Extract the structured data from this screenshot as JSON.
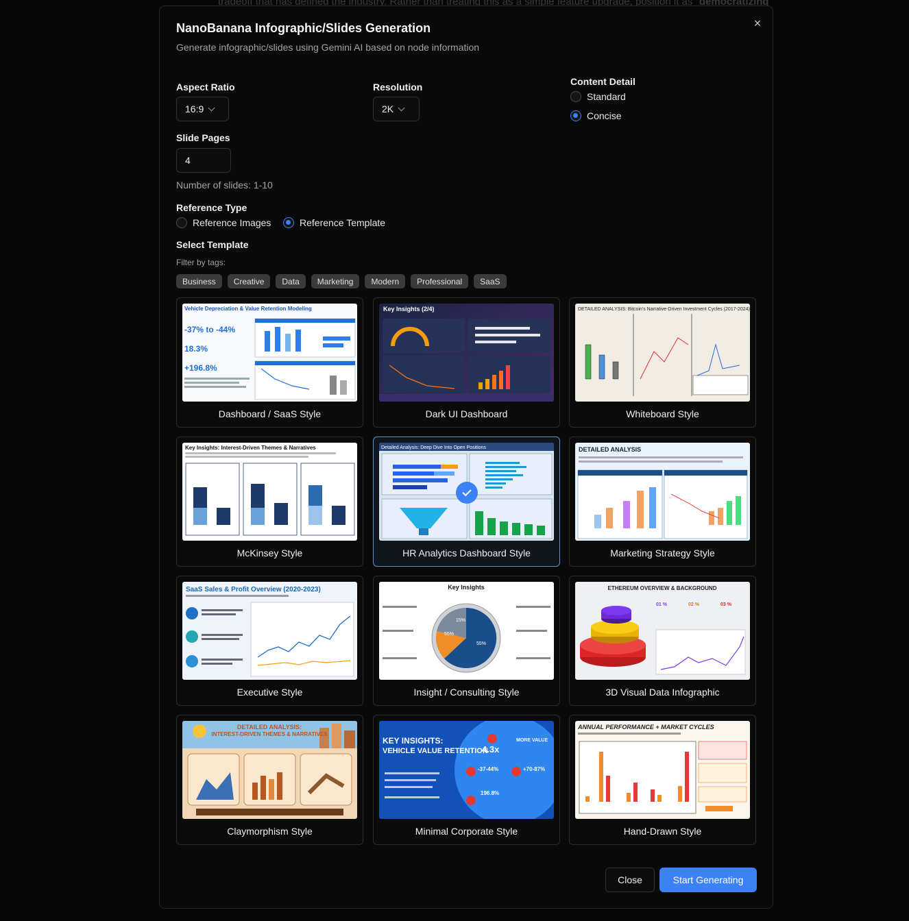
{
  "background": {
    "text": "tradeoff that has defined the industry. Rather than treating this as a simple feature upgrade, position it as",
    "bold": "democratizing"
  },
  "dialog": {
    "title": "NanoBanana Infographic/Slides Generation",
    "subtitle": "Generate infographic/slides using Gemini AI based on node information",
    "close_icon": "×"
  },
  "aspect_ratio": {
    "label": "Aspect Ratio",
    "value": "16:9"
  },
  "resolution": {
    "label": "Resolution",
    "value": "2K"
  },
  "content_detail": {
    "label": "Content Detail",
    "options": [
      "Standard",
      "Concise"
    ],
    "selected": "Concise"
  },
  "slide_pages": {
    "label": "Slide Pages",
    "value": "4",
    "hint": "Number of slides: 1-10"
  },
  "reference_type": {
    "label": "Reference Type",
    "options": [
      "Reference Images",
      "Reference Template"
    ],
    "selected": "Reference Template"
  },
  "select_template": {
    "label": "Select Template",
    "filter_label": "Filter by tags:",
    "tags": [
      "Business",
      "Creative",
      "Data",
      "Marketing",
      "Modern",
      "Professional",
      "SaaS"
    ]
  },
  "templates": [
    {
      "name": "Dashboard / SaaS Style",
      "thumb_title": "Vehicle Depreciation & Value Retention Modeling",
      "stats": [
        "-37% to -44%",
        "18.3%",
        "+196.8%"
      ]
    },
    {
      "name": "Dark UI Dashboard",
      "thumb_title": "Key Insights (2/4)"
    },
    {
      "name": "Whiteboard Style",
      "thumb_title": "DETAILED ANALYSIS: Bitcoin's Narrative-Driven Investment Cycles (2017-2024)"
    },
    {
      "name": "McKinsey Style",
      "thumb_title": "Key Insights: Interest-Driven Themes & Narratives"
    },
    {
      "name": "HR Analytics Dashboard Style",
      "thumb_title": "Detailed Analysis: Deep Dive Into Open Positions",
      "selected": true
    },
    {
      "name": "Marketing Strategy Style",
      "thumb_title": "DETAILED ANALYSIS"
    },
    {
      "name": "Executive Style",
      "thumb_title": "SaaS Sales & Profit Overview (2020-2023)"
    },
    {
      "name": "Insight / Consulting Style",
      "thumb_title": "Key Insights",
      "stats": [
        "15%",
        "55%",
        "55%"
      ]
    },
    {
      "name": "3D Visual Data Infographic",
      "thumb_title": "ETHEREUM OVERVIEW & BACKGROUND",
      "stats": [
        "01 %",
        "02 %",
        "03 %"
      ]
    },
    {
      "name": "Claymorphism Style",
      "thumb_title": "DETAILED ANALYSIS:",
      "thumb_subtitle": "INTEREST-DRIVEN THEMES & NARRATIVES"
    },
    {
      "name": "Minimal Corporate Style",
      "thumb_title": "KEY INSIGHTS:",
      "thumb_subtitle": "VEHICLE VALUE RETENTION",
      "stats": [
        "4.3x",
        "-37-44%",
        "+70-87%",
        "196.8%"
      ],
      "more_value": "MORE VALUE"
    },
    {
      "name": "Hand-Drawn Style",
      "thumb_title": "ANNUAL PERFORMANCE + MARKET CYCLES"
    }
  ],
  "footer": {
    "close_label": "Close",
    "start_label": "Start Generating"
  },
  "colors": {
    "accent": "#3b82f6",
    "modal_bg": "#0a0a0a",
    "tag_bg": "#3a3a3a"
  }
}
